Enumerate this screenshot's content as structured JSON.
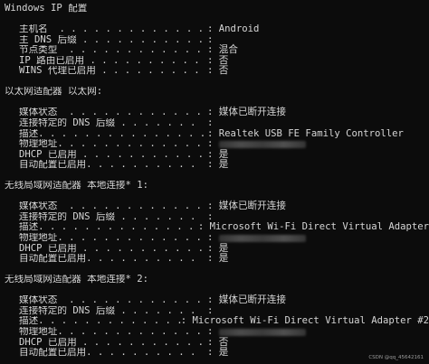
{
  "header": {
    "title": "Windows IP 配置"
  },
  "host": {
    "rows": [
      {
        "key": "主机名  . . . . . . . . . . . . .",
        "value": "Android"
      },
      {
        "key": "主 DNS 后缀 . . . . . . . . . . .",
        "value": ""
      },
      {
        "key": "节点类型  . . . . . . . . . . . .",
        "value": "混合"
      },
      {
        "key": "IP 路由已启用 . . . . . . . . . .",
        "value": "否"
      },
      {
        "key": "WINS 代理已启用 . . . . . . . . .",
        "value": "否"
      }
    ]
  },
  "adapters": [
    {
      "header": "以太网适配器 以太网:",
      "rows": [
        {
          "key": "媒体状态  . . . . . . . . . . . .",
          "value": "媒体已断开连接"
        },
        {
          "key": "连接特定的 DNS 后缀 . . . . . . .",
          "value": ""
        },
        {
          "key": "描述. . . . . . . . . . . . . . .",
          "value": "Realtek USB FE Family Controller"
        },
        {
          "key": "物理地址. . . . . . . . . . . . .",
          "value": "",
          "blurred": true
        },
        {
          "key": "DHCP 已启用 . . . . . . . . . . .",
          "value": "是"
        },
        {
          "key": "自动配置已启用. . . . . . . . . .",
          "value": "是"
        }
      ]
    },
    {
      "header": "无线局域网适配器 本地连接* 1:",
      "rows": [
        {
          "key": "媒体状态  . . . . . . . . . . . .",
          "value": "媒体已断开连接"
        },
        {
          "key": "连接特定的 DNS 后缀 . . . . . . .",
          "value": ""
        },
        {
          "key": "描述. . . . . . . . . . . . . . .",
          "value": "Microsoft Wi-Fi Direct Virtual Adapter"
        },
        {
          "key": "物理地址. . . . . . . . . . . . .",
          "value": "",
          "blurred": true
        },
        {
          "key": "DHCP 已启用 . . . . . . . . . . .",
          "value": "是"
        },
        {
          "key": "自动配置已启用. . . . . . . . . .",
          "value": "是"
        }
      ]
    },
    {
      "header": "无线局域网适配器 本地连接* 2:",
      "rows": [
        {
          "key": "媒体状态  . . . . . . . . . . . .",
          "value": "媒体已断开连接"
        },
        {
          "key": "连接特定的 DNS 后缀 . . . . . . .",
          "value": ""
        },
        {
          "key": "描述. . . . . . . . . . . . . . .",
          "value": "Microsoft Wi-Fi Direct Virtual Adapter #2"
        },
        {
          "key": "物理地址. . . . . . . . . . . . .",
          "value": "",
          "blurred": true
        },
        {
          "key": "DHCP 已启用 . . . . . . . . . . .",
          "value": "否"
        },
        {
          "key": "自动配置已启用. . . . . . . . . .",
          "value": "是"
        }
      ]
    }
  ],
  "watermark": "CSDN @qq_45642161"
}
